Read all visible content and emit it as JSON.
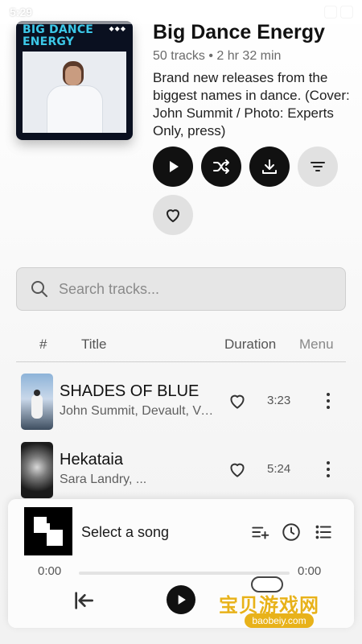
{
  "status_bar": {
    "time": "5:29"
  },
  "playlist": {
    "cover_text": "BIG DANCE ENERGY",
    "title": "Big Dance Energy",
    "meta": "50 tracks • 2 hr 32 min",
    "description": "Brand new releases from the biggest names in dance. (Cover: John Summit / Photo: Experts Only, press)"
  },
  "actions": [
    {
      "icon": "play-icon"
    },
    {
      "icon": "shuffle-icon"
    },
    {
      "icon": "download-icon"
    },
    {
      "icon": "filter-icon"
    },
    {
      "icon": "heart-icon"
    }
  ],
  "search": {
    "placeholder": "Search tracks..."
  },
  "table": {
    "headers": {
      "num": "#",
      "title": "Title",
      "duration": "Duration",
      "menu": "Menu"
    }
  },
  "tracks": [
    {
      "title": "SHADES OF BLUE",
      "artist": "John Summit, Devault, Venessa Michaels",
      "duration": "3:23"
    },
    {
      "title": "Hekataia",
      "artist": "Sara Landry, ...",
      "duration": "5:24"
    }
  ],
  "player": {
    "title": "Select a song",
    "current_time": "0:00",
    "end_time": "0:00",
    "progress": 0
  },
  "watermark": {
    "text": "宝贝游戏网",
    "url": "baobeiy.com"
  }
}
